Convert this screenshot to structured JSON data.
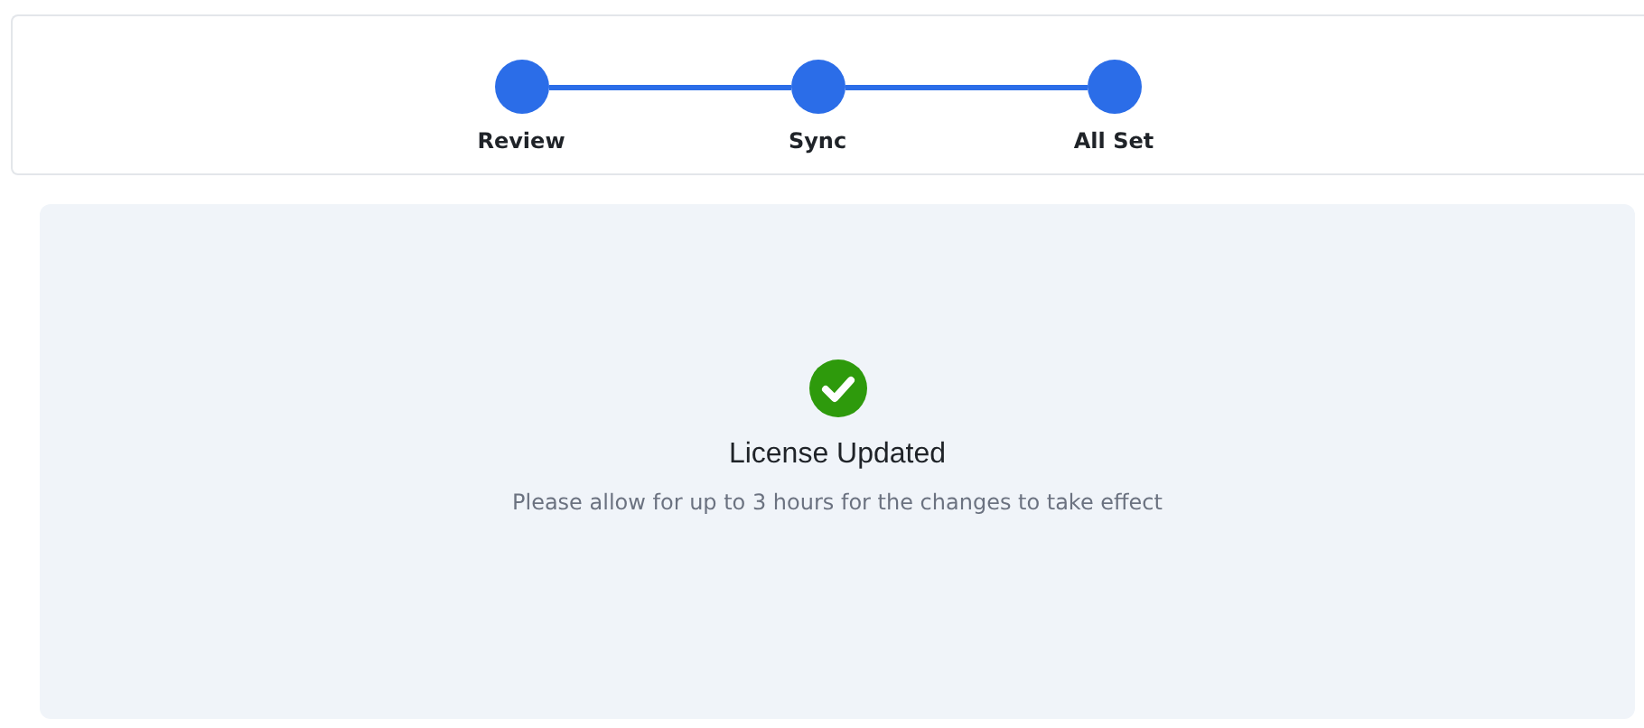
{
  "steps": [
    {
      "label": "Review",
      "completed": true
    },
    {
      "label": "Sync",
      "completed": true
    },
    {
      "label": "All Set",
      "completed": true
    }
  ],
  "result": {
    "kind": "success",
    "title": "License Updated",
    "message": "Please allow for up to 3 hours for the changes to take effect"
  }
}
